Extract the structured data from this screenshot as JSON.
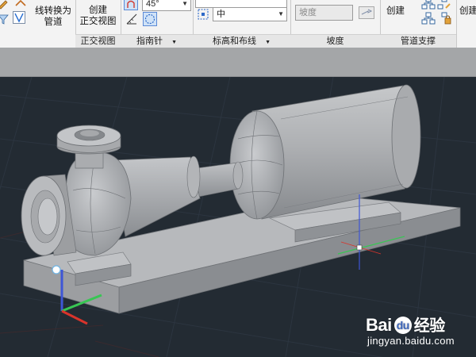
{
  "ribbon": {
    "panels": [
      {
        "title": "",
        "items": {
          "convert_line_label_1": "线转换为",
          "convert_line_label_2": "管道"
        }
      },
      {
        "title": "正交视图",
        "items": {
          "create_label_1": "创建",
          "create_label_2": "正交视图"
        }
      },
      {
        "title": "指南针",
        "items": {
          "angle_value": "45°"
        }
      },
      {
        "title": "标高和布线",
        "items": {
          "elevation_value": "中"
        }
      },
      {
        "title": "坡度",
        "items": {
          "slope_placeholder": "坡度"
        }
      },
      {
        "title": "管道支撑",
        "items": {
          "create_label": "创建"
        }
      },
      {
        "title": "",
        "items": {
          "create_label": "创建"
        }
      }
    ],
    "panel_menu_arrow": "▼"
  },
  "viewport": {
    "background": "#232b33",
    "ucs_axes": {
      "x_color": "#d9342b",
      "y_color": "#38c653",
      "z_color": "#3e56d6"
    },
    "crosshair": {
      "x_color": "#d9342b",
      "y_color": "#38c653",
      "z_color": "#3e56d6"
    }
  },
  "watermark": {
    "brand_left": "Bai",
    "brand_circle": "du",
    "brand_right": "经验",
    "url": "jingyan.baidu.com"
  }
}
